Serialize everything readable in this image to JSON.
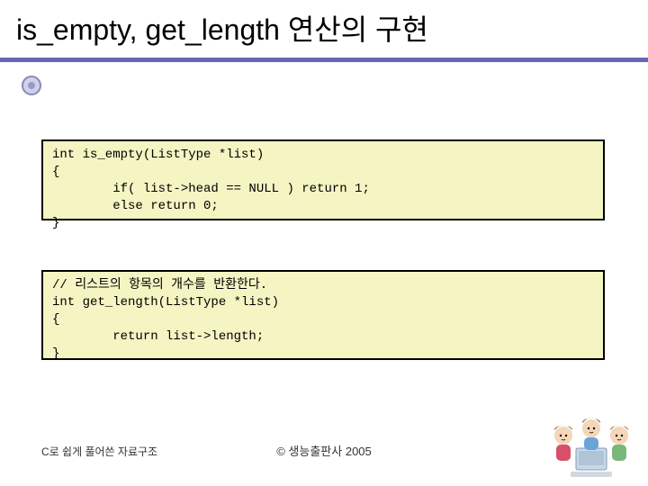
{
  "title": "is_empty, get_length 연산의 구현",
  "code_block_1": "int is_empty(ListType *list)\n{\n        if( list->head == NULL ) return 1;\n        else return 0;\n}",
  "code_block_2": "// 리스트의 항목의 개수를 반환한다.\nint get_length(ListType *list)\n{\n        return list->length;\n}",
  "footer_left": "C로 쉽게 풀어쓴 자료구조",
  "footer_center": "© 생능출판사 2005"
}
